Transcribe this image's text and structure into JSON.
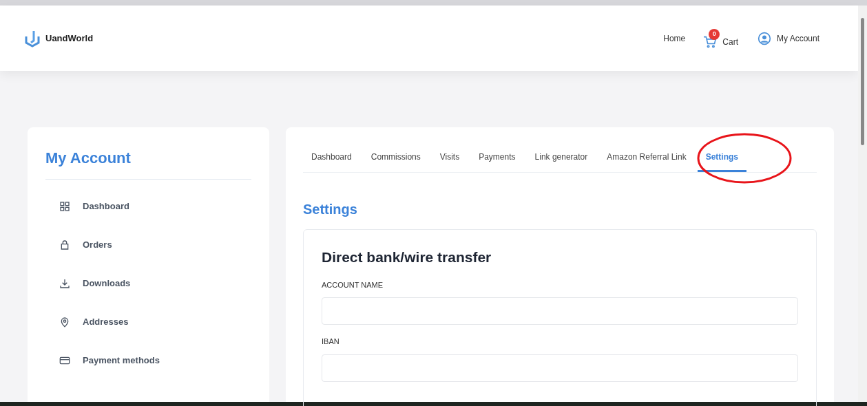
{
  "header": {
    "brand": "UandWorld",
    "nav": [
      {
        "kind": "link",
        "label": "Home"
      },
      {
        "kind": "cart",
        "label": "Cart",
        "badge": "0"
      },
      {
        "kind": "account",
        "label": "My Account"
      }
    ]
  },
  "sidebar": {
    "title": "My Account",
    "items": [
      {
        "kind": "grid",
        "label": "Dashboard"
      },
      {
        "kind": "bag",
        "label": "Orders"
      },
      {
        "kind": "download",
        "label": "Downloads"
      },
      {
        "kind": "pin",
        "label": "Addresses"
      },
      {
        "kind": "card",
        "label": "Payment methods"
      }
    ]
  },
  "tabs": [
    {
      "label": "Dashboard",
      "selected": false
    },
    {
      "label": "Commissions",
      "selected": false
    },
    {
      "label": "Visits",
      "selected": false
    },
    {
      "label": "Payments",
      "selected": false
    },
    {
      "label": "Link generator",
      "selected": false
    },
    {
      "label": "Amazon Referral Link",
      "selected": false
    },
    {
      "label": "Settings",
      "selected": true
    }
  ],
  "page_title": "Settings",
  "section": {
    "title": "Direct bank/wire transfer",
    "fields": [
      {
        "label": "ACCOUNT NAME"
      },
      {
        "label": "IBAN"
      }
    ]
  }
}
